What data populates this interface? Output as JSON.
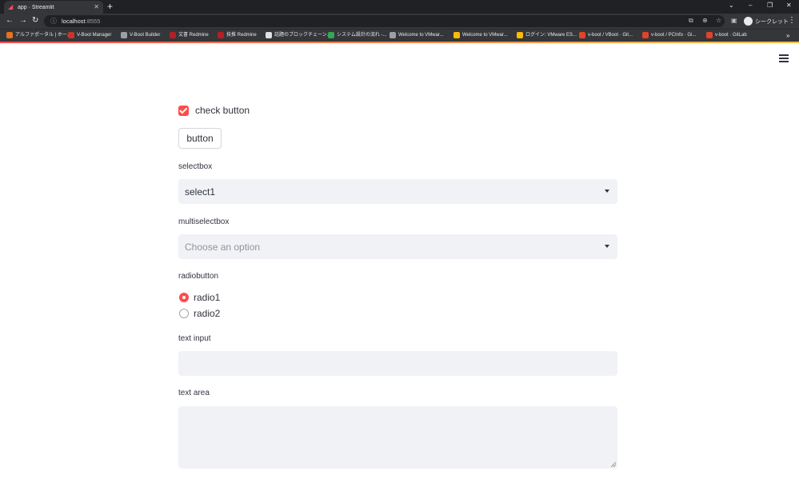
{
  "browser": {
    "tab_title": "app · Streamlit",
    "tab_close": "✕",
    "new_tab": "+",
    "window_controls": [
      "⌄",
      "–",
      "❐",
      "✕"
    ],
    "nav": {
      "back": "←",
      "forward": "→",
      "reload": "↻"
    },
    "address": {
      "info_icon": "ⓘ",
      "host": "localhost",
      "port": ":8555"
    },
    "profile_label": "シークレット",
    "menu": "⋮",
    "bookmarks": [
      {
        "label": "アルファポータル | ホー...",
        "color": "#e8711a"
      },
      {
        "label": "V-Boot Manager",
        "color": "#c5372c"
      },
      {
        "label": "V-Boot Builder",
        "color": "#9aa0a6"
      },
      {
        "label": "文書 Redmine",
        "color": "#b32024"
      },
      {
        "label": "技推 Redmine",
        "color": "#b32024"
      },
      {
        "label": "話題のブロックチェーン...",
        "color": "#dfe1e5"
      },
      {
        "label": "システム設計の流れ -...",
        "color": "#34a853"
      },
      {
        "label": "Welcome to VMwar...",
        "color": "#9aa0a6"
      },
      {
        "label": "Welcome to VMwar...",
        "color": "#fbbc04"
      },
      {
        "label": "ログイン: VMware ES...",
        "color": "#fbbc04"
      },
      {
        "label": "v-boot / VBoot · Git...",
        "color": "#e24329"
      },
      {
        "label": "v-boot / PCInfo · Gi...",
        "color": "#e24329"
      },
      {
        "label": "v-boot · GitLab",
        "color": "#e24329"
      }
    ],
    "bookmarks_more": "»"
  },
  "app": {
    "checkbox": {
      "label": "check button",
      "checked": true
    },
    "button": {
      "label": "button"
    },
    "selectbox": {
      "label": "selectbox",
      "value": "select1"
    },
    "multiselect": {
      "label": "multiselectbox",
      "placeholder": "Choose an option"
    },
    "radio": {
      "label": "radiobutton",
      "options": [
        "radio1",
        "radio2"
      ],
      "selected": "radio1"
    },
    "text_input": {
      "label": "text input",
      "value": ""
    },
    "text_area": {
      "label": "text area",
      "value": ""
    }
  },
  "colors": {
    "primary": "#ff4b4b",
    "field_bg": "#f0f2f6",
    "text": "#31333f"
  }
}
